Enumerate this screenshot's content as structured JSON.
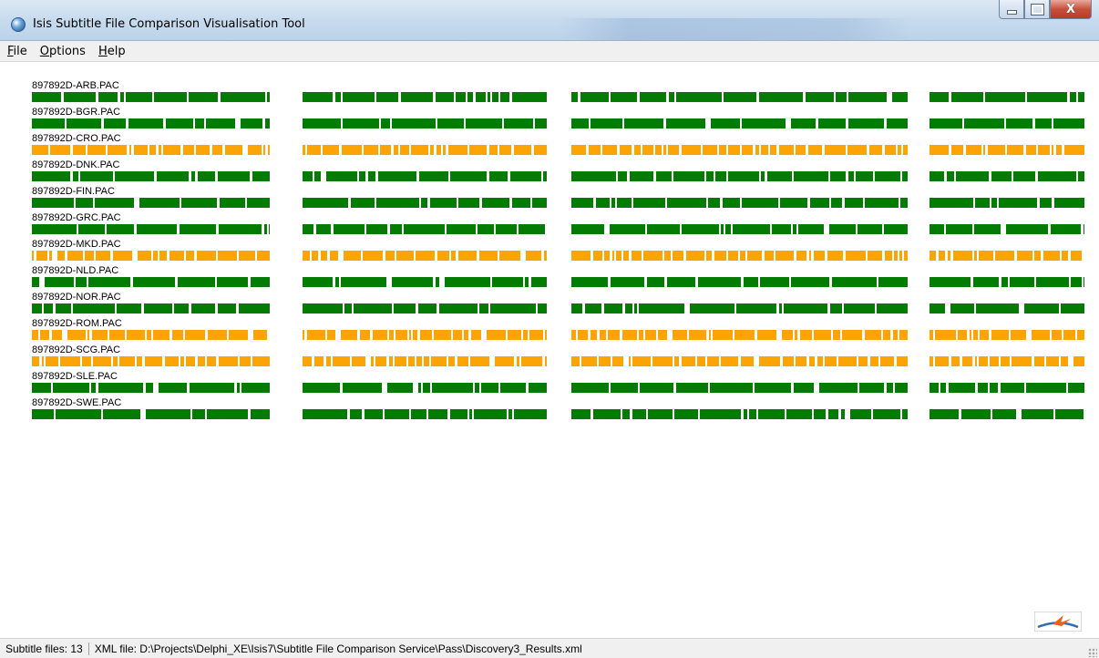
{
  "window": {
    "title": "Isis Subtitle File Comparison Visualisation Tool",
    "minimize_icon": "minimize-icon",
    "maximize_icon": "maximize-icon",
    "close_icon": "close-icon",
    "close_glyph": "X"
  },
  "menu": {
    "items": [
      {
        "accel": "F",
        "rest": "ile"
      },
      {
        "accel": "O",
        "rest": "ptions"
      },
      {
        "accel": "H",
        "rest": "elp"
      }
    ]
  },
  "colors": {
    "match": "#047c04",
    "mismatch": "#fca404"
  },
  "files": [
    {
      "name": "897892D-ARB.PAC",
      "status": "match"
    },
    {
      "name": "897892D-BGR.PAC",
      "status": "match"
    },
    {
      "name": "897892D-CRO.PAC",
      "status": "mismatch"
    },
    {
      "name": "897892D-DNK.PAC",
      "status": "match"
    },
    {
      "name": "897892D-FIN.PAC",
      "status": "match"
    },
    {
      "name": "897892D-GRC.PAC",
      "status": "match"
    },
    {
      "name": "897892D-MKD.PAC",
      "status": "mismatch"
    },
    {
      "name": "897892D-NLD.PAC",
      "status": "match"
    },
    {
      "name": "897892D-NOR.PAC",
      "status": "match"
    },
    {
      "name": "897892D-ROM.PAC",
      "status": "mismatch"
    },
    {
      "name": "897892D-SCG.PAC",
      "status": "mismatch"
    },
    {
      "name": "897892D-SLE.PAC",
      "status": "match"
    },
    {
      "name": "897892D-SWE.PAC",
      "status": "match"
    }
  ],
  "status": {
    "subtitle_files": "Subtitle files: 13",
    "xml_file": "XML file: D:\\Projects\\Delphi_XE\\Isis7\\Subtitle File Comparison Service\\Pass\\Discovery3_Results.xml"
  },
  "logo_icon": "company-logo-icon"
}
